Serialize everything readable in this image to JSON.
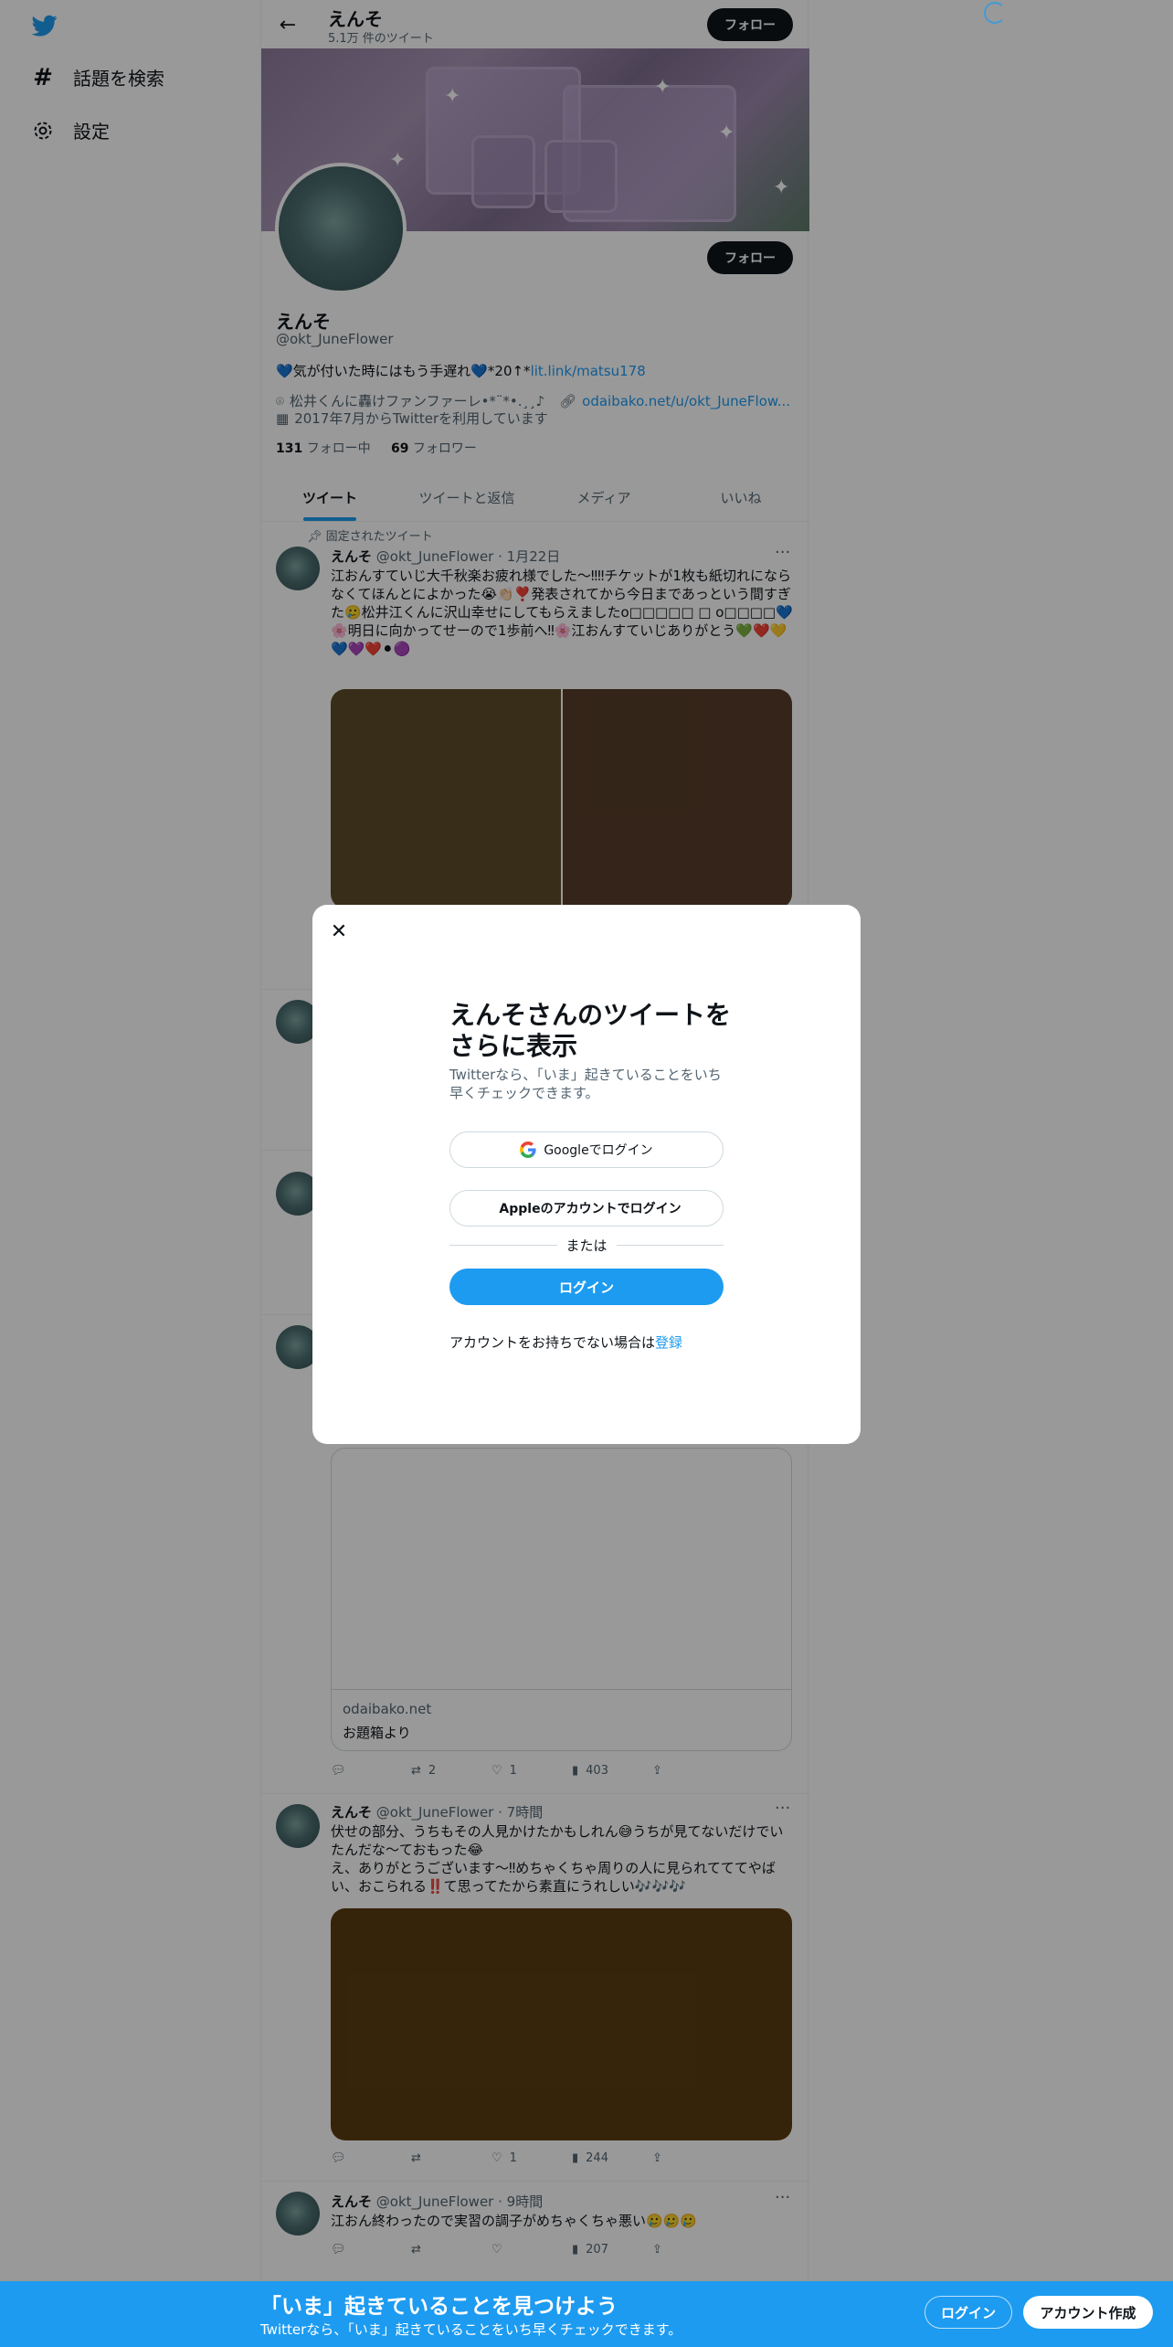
{
  "sidebar": {
    "items": [
      {
        "label": "話題を検索",
        "icon": "hashtag-icon"
      },
      {
        "label": "設定",
        "icon": "gear-icon"
      }
    ]
  },
  "topbar": {
    "name": "えんそ",
    "tweet_count": "5.1万 件のツイート",
    "follow_label": "フォロー"
  },
  "profile": {
    "follow_label": "フォロー",
    "name": "えんそ",
    "handle": "@okt_JuneFlower",
    "bio_text": "💙気が付いた時にはもう手遅れ💙*20↑*",
    "bio_link": "lit.link/matsu178",
    "location": "松井くんに轟けファンファーレ•*¨*•.¸¸♪",
    "website": "odaibako.net/u/okt_JuneFlow...",
    "joined": "2017年7月からTwitterを利用しています",
    "following_count": "131",
    "following_label": "フォロー中",
    "followers_count": "69",
    "followers_label": "フォロワー"
  },
  "tabs": [
    "ツイート",
    "ツイートと返信",
    "メディア",
    "いいね"
  ],
  "pinned_label": "固定されたツイート",
  "tweets": [
    {
      "name": "えんそ",
      "meta": "@okt_JuneFlower · 1月22日",
      "text": "江おんすていじ大千秋楽お疲れ様でした〜‼︎‼︎チケットが1枚も紙切れにならなくてほんとによかった😭👏🏻❣️発表されてから今日まであっという間すぎた🥲松井江くんに沢山幸せにしてもらえましたo□□□□□ □ o□□□□💙\n🌸明日に向かってせーので1歩前へ‼︎🌸江おんすていじありがとう💚❤️💛💙💜❤️⚫🟣"
    },
    {
      "card_domain": "odaibako.net",
      "card_title": "お題箱より",
      "retweets": "2",
      "likes": "1",
      "views": "403"
    },
    {
      "name": "えんそ",
      "meta": "@okt_JuneFlower · 7時間",
      "text": "伏せの部分、うちもその人見かけたかもしれん😅うちが見てないだけでいたんだな〜ておもった😂\nえ、ありがとうございます〜‼︎めちゃくちゃ周りの人に見られてててやばい、おこられる‼️て思ってたから素直にうれしい🎶🎶🎶",
      "likes": "1",
      "views": "244"
    },
    {
      "name": "えんそ",
      "meta": "@okt_JuneFlower · 9時間",
      "text": "江おん終わったので実習の調子がめちゃくちゃ悪い🥲🥲🥲",
      "views": "207"
    }
  ],
  "modal": {
    "title": "えんそさんのツイートをさらに表示",
    "subtitle": "Twitterなら、「いま」起きていることをいち早くチェックできます。",
    "google_label": "Googleでログイン",
    "apple_label": "Appleのアカウントでログイン",
    "or_label": "または",
    "login_label": "ログイン",
    "signup_text": "アカウントをお持ちでない場合は",
    "signup_link": "登録"
  },
  "bottombar": {
    "title": "「いま」起きていることを見つけよう",
    "subtitle": "Twitterなら、「いま」起きていることをいち早くチェックできます。",
    "login_label": "ログイン",
    "signup_label": "アカウント作成"
  },
  "colors": {
    "accent": "#1d9bf0",
    "text": "#0f1419",
    "muted": "#536471",
    "overlay": "rgba(0,0,0,0.4)"
  }
}
